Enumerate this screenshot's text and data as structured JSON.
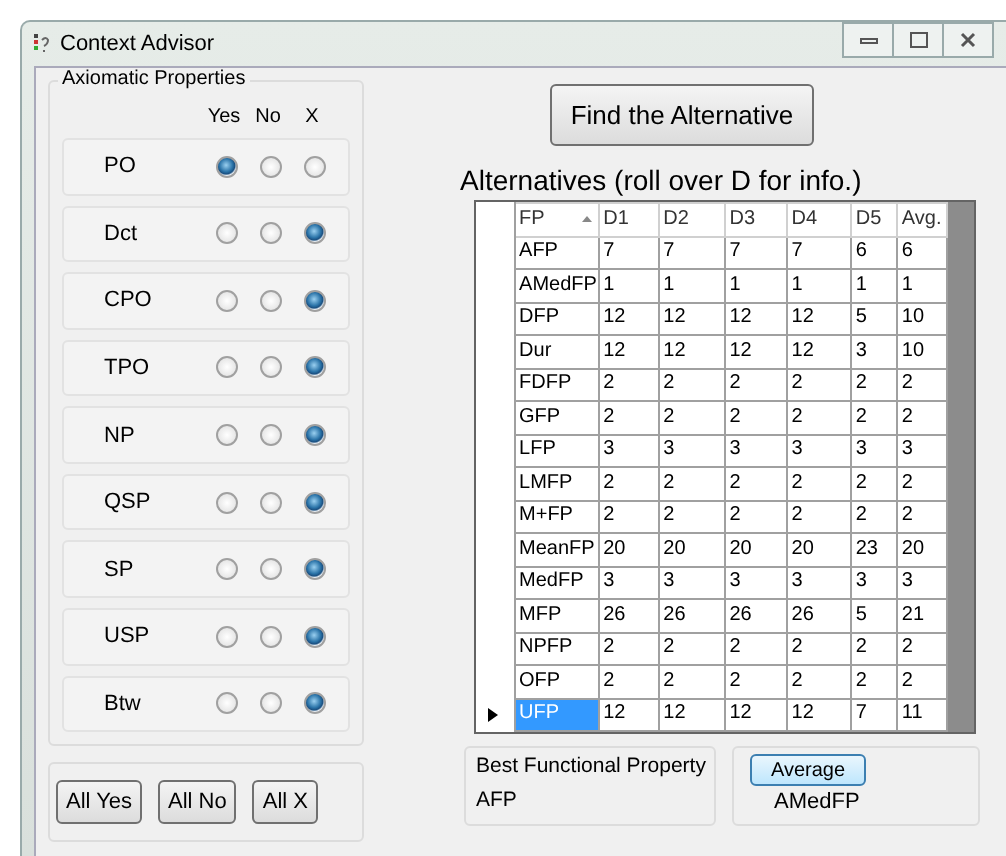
{
  "window": {
    "title": "Context Advisor"
  },
  "properties": {
    "title": "Axiomatic Properties",
    "option_labels": [
      "Yes",
      "No",
      "X"
    ],
    "items": [
      {
        "name": "PO",
        "options": [
          {
            "selected": true
          },
          {
            "selected": false
          },
          {
            "selected": false
          }
        ]
      },
      {
        "name": "Dct",
        "options": [
          {
            "selected": false
          },
          {
            "selected": false
          },
          {
            "selected": true
          }
        ]
      },
      {
        "name": "CPO",
        "options": [
          {
            "selected": false
          },
          {
            "selected": false
          },
          {
            "selected": true
          }
        ]
      },
      {
        "name": "TPO",
        "options": [
          {
            "selected": false
          },
          {
            "selected": false
          },
          {
            "selected": true
          }
        ]
      },
      {
        "name": "NP",
        "options": [
          {
            "selected": false
          },
          {
            "selected": false
          },
          {
            "selected": true
          }
        ]
      },
      {
        "name": "QSP",
        "options": [
          {
            "selected": false
          },
          {
            "selected": false
          },
          {
            "selected": true
          }
        ]
      },
      {
        "name": "SP",
        "options": [
          {
            "selected": false
          },
          {
            "selected": false
          },
          {
            "selected": true
          }
        ]
      },
      {
        "name": "USP",
        "options": [
          {
            "selected": false
          },
          {
            "selected": false
          },
          {
            "selected": true
          }
        ]
      },
      {
        "name": "Btw",
        "options": [
          {
            "selected": false
          },
          {
            "selected": false
          },
          {
            "selected": true
          }
        ]
      }
    ]
  },
  "bulk_buttons": [
    "All Yes",
    "All No",
    "All X"
  ],
  "find_button": "Find the Alternative",
  "table": {
    "title": "Alternatives (roll over D for info.)",
    "columns": [
      {
        "label": "FP",
        "sorted": true
      },
      {
        "label": "D1",
        "sorted": false
      },
      {
        "label": "D2",
        "sorted": false
      },
      {
        "label": "D3",
        "sorted": false
      },
      {
        "label": "D4",
        "sorted": false
      },
      {
        "label": "D5",
        "sorted": false
      },
      {
        "label": "Avg.",
        "sorted": false
      }
    ],
    "rows": [
      {
        "cells": [
          "AFP",
          "7",
          "7",
          "7",
          "7",
          "6",
          "6"
        ],
        "selected": false
      },
      {
        "cells": [
          "AMedFP",
          "1",
          "1",
          "1",
          "1",
          "1",
          "1"
        ],
        "selected": false
      },
      {
        "cells": [
          "DFP",
          "12",
          "12",
          "12",
          "12",
          "5",
          "10"
        ],
        "selected": false
      },
      {
        "cells": [
          "Dur",
          "12",
          "12",
          "12",
          "12",
          "3",
          "10"
        ],
        "selected": false
      },
      {
        "cells": [
          "FDFP",
          "2",
          "2",
          "2",
          "2",
          "2",
          "2"
        ],
        "selected": false
      },
      {
        "cells": [
          "GFP",
          "2",
          "2",
          "2",
          "2",
          "2",
          "2"
        ],
        "selected": false
      },
      {
        "cells": [
          "LFP",
          "3",
          "3",
          "3",
          "3",
          "3",
          "3"
        ],
        "selected": false
      },
      {
        "cells": [
          "LMFP",
          "2",
          "2",
          "2",
          "2",
          "2",
          "2"
        ],
        "selected": false
      },
      {
        "cells": [
          "M+FP",
          "2",
          "2",
          "2",
          "2",
          "2",
          "2"
        ],
        "selected": false
      },
      {
        "cells": [
          "MeanFP",
          "20",
          "20",
          "20",
          "20",
          "23",
          "20"
        ],
        "selected": false
      },
      {
        "cells": [
          "MedFP",
          "3",
          "3",
          "3",
          "3",
          "3",
          "3"
        ],
        "selected": false
      },
      {
        "cells": [
          "MFP",
          "26",
          "26",
          "26",
          "26",
          "5",
          "21"
        ],
        "selected": false
      },
      {
        "cells": [
          "NPFP",
          "2",
          "2",
          "2",
          "2",
          "2",
          "2"
        ],
        "selected": false
      },
      {
        "cells": [
          "OFP",
          "2",
          "2",
          "2",
          "2",
          "2",
          "2"
        ],
        "selected": false
      },
      {
        "cells": [
          "UFP",
          "12",
          "12",
          "12",
          "12",
          "7",
          "11"
        ],
        "selected": true
      }
    ]
  },
  "best": {
    "label": "Best Functional Property",
    "value": "AFP"
  },
  "average": {
    "button": "Average",
    "value": "AMedFP"
  }
}
